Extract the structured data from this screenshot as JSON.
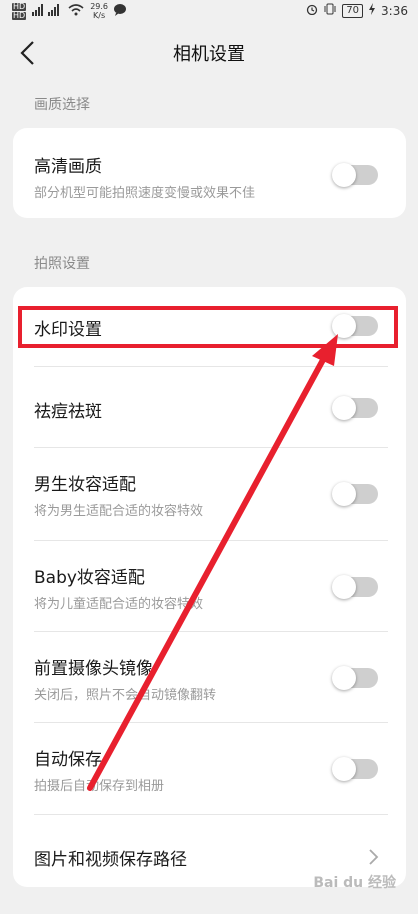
{
  "status_bar": {
    "net_a": "HD",
    "net_b": "HD",
    "signal": "4G",
    "speed_value": "29.6",
    "speed_unit": "K/s",
    "battery": "70",
    "time": "3:36"
  },
  "header": {
    "title": "相机设置"
  },
  "sections": {
    "quality": {
      "label": "画质选择",
      "items": [
        {
          "title": "高清画质",
          "subtitle": "部分机型可能拍照速度变慢或效果不佳",
          "on": false
        }
      ]
    },
    "photo": {
      "label": "拍照设置",
      "items": [
        {
          "title": "水印设置",
          "on": false
        },
        {
          "title": "祛痘祛斑",
          "on": false
        },
        {
          "title": "男生妆容适配",
          "subtitle": "将为男生适配合适的妆容特效",
          "on": false
        },
        {
          "title": "Baby妆容适配",
          "subtitle": "将为儿童适配合适的妆容特效",
          "on": false
        },
        {
          "title": "前置摄像头镜像",
          "subtitle": "关闭后，照片不会自动镜像翻转",
          "on": false
        },
        {
          "title": "自动保存",
          "subtitle": "拍摄后自动保存到相册",
          "on": false
        },
        {
          "title": "图片和视频保存路径"
        }
      ]
    }
  },
  "watermark": "Bai du 经验",
  "colors": {
    "highlight": "#e8202e",
    "toggle_off": "#cfcfcf"
  }
}
